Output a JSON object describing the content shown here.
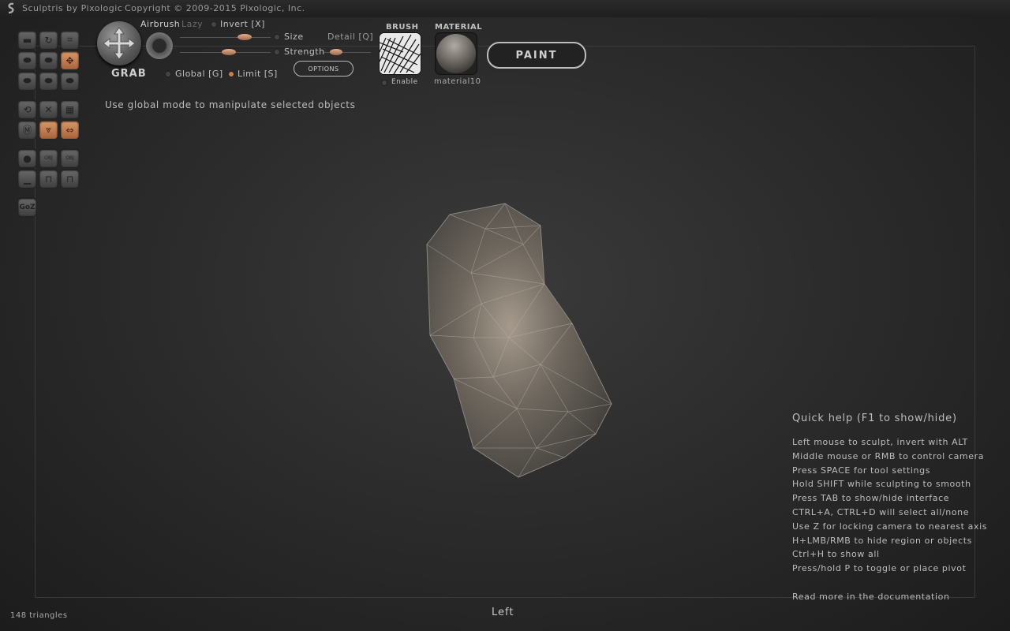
{
  "titlebar": {
    "app_name": "Sculptris by Pixologic",
    "copyright": "Copyright © 2009-2015 Pixologic, Inc."
  },
  "toolbar": {
    "tool_label": "GRAB",
    "airbrush_label": "Airbrush",
    "lazy_label": "Lazy",
    "invert_label": "Invert [X]",
    "size_label": "Size",
    "detail_label": "Detail [Q]",
    "strength_label": "Strength",
    "global_label": "Global [G]",
    "limit_label": "Limit [S]",
    "options_label": "OPTIONS",
    "brush_title": "BRUSH",
    "brush_enable_label": "Enable",
    "material_title": "MATERIAL",
    "material_name": "material10",
    "paint_label": "PAINT",
    "size_value": 0.75,
    "strength_value": 0.55,
    "detail_value": 0.2
  },
  "tools": {
    "icons": [
      "flatten-icon",
      "rotate-icon",
      "crop-icon",
      "inflate-icon",
      "pinch-icon",
      "grab-move-icon",
      "smooth-icon",
      "layer-icon",
      "crease-icon",
      "symmetry-icon",
      "wireframe-icon",
      "grid-icon",
      "material-icon",
      "reduce-icon",
      "mirror-icon",
      "sphere-icon",
      "import-obj-icon",
      "export-obj-icon",
      "plane-icon",
      "lock-icon",
      "house-icon",
      "goz-icon"
    ],
    "goz_label": "GoZ"
  },
  "hint": "Use global mode to manipulate selected objects",
  "quick_help": {
    "title": "Quick help (F1 to show/hide)",
    "lines": [
      "Left mouse to sculpt, invert with ALT",
      "Middle mouse or RMB to control camera",
      "Press SPACE for tool settings",
      "Hold SHIFT while sculpting to smooth",
      "Press TAB to show/hide interface",
      "CTRL+A, CTRL+D will select all/none",
      "Use Z for locking camera to nearest axis",
      "H+LMB/RMB to hide region or objects",
      "Ctrl+H to show all",
      "Press/hold P to toggle or place pivot"
    ],
    "more": "Read more in the documentation"
  },
  "status": {
    "triangles": "148 triangles",
    "view": "Left"
  },
  "colors": {
    "accent": "#c8804e",
    "background": "#2c2c2c"
  }
}
